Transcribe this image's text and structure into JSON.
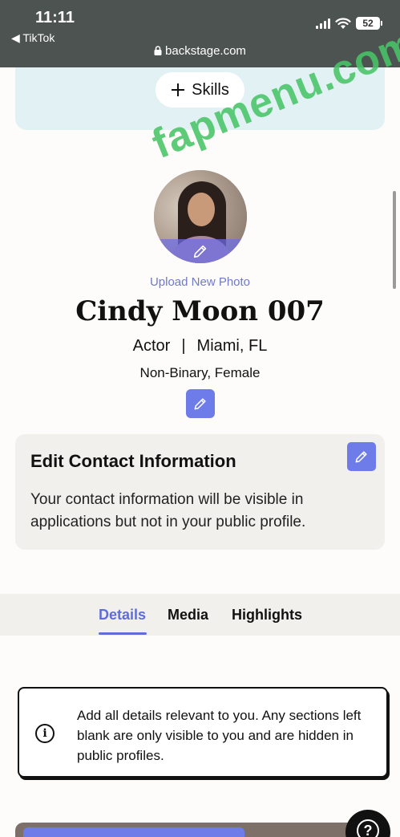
{
  "status_bar": {
    "time": "11:11",
    "back_label": "◀ TikTok",
    "battery": "52",
    "url": "backstage.com"
  },
  "skills_button": {
    "label": "Skills"
  },
  "watermark": "fapmenu.com",
  "profile": {
    "upload_label": "Upload New Photo",
    "name": "Cindy Moon 007",
    "role": "Actor",
    "location": "Miami, FL",
    "separator": "|",
    "gender": "Non-Binary, Female"
  },
  "contact": {
    "title": "Edit Contact Information",
    "description": "Your contact information will be visible in applications but not in your public profile."
  },
  "tabs": [
    {
      "label": "Details",
      "active": true
    },
    {
      "label": "Media",
      "active": false
    },
    {
      "label": "Highlights",
      "active": false
    }
  ],
  "info": {
    "text": "Add all details relevant to you. Any sections left blank are only visible to you and are hidden in public profiles."
  },
  "colors": {
    "accent": "#6d7ce8",
    "status_bar": "#4d5350",
    "skills_card": "#e2f1f3",
    "watermark": "#48c466"
  }
}
